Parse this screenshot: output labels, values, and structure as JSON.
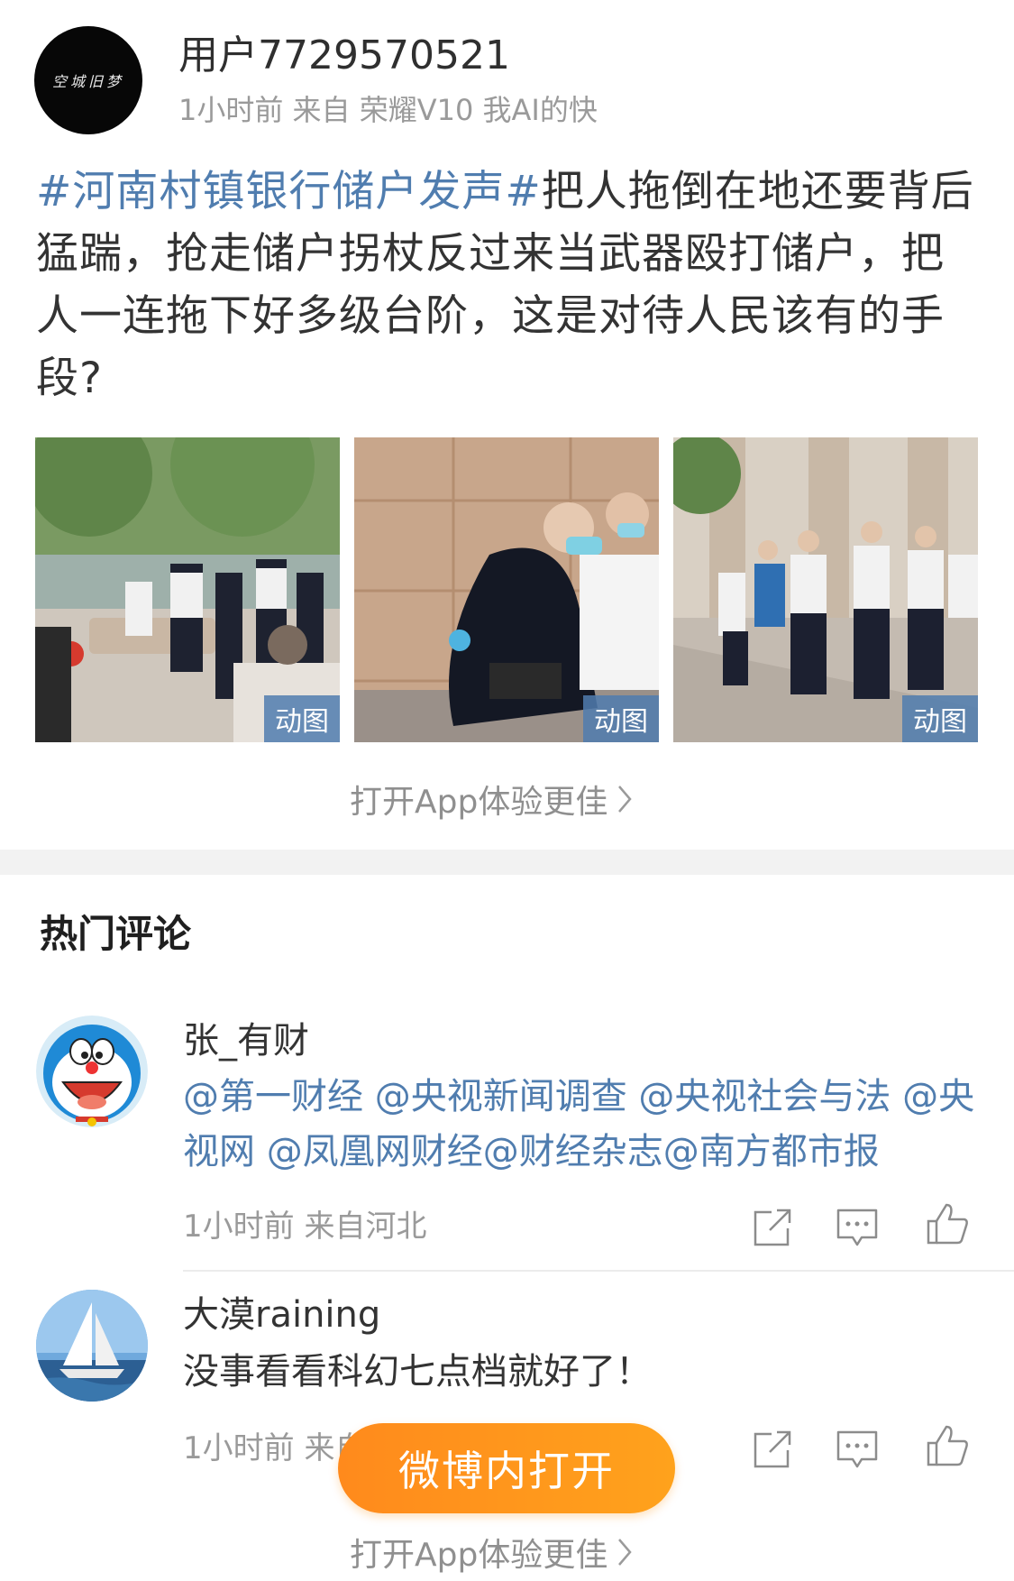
{
  "post": {
    "avatar_text": "空城旧梦",
    "username": "用户7729570521",
    "meta": "1小时前  来自 荣耀V10 我AI的快",
    "hashtag": "#河南村镇银行储户发声#",
    "text": "把人拖倒在地还要背后猛踹，抢走储户拐杖反过来当武器殴打储户，把人一连拖下好多级台阶，这是对待人民该有的手段?",
    "images": [
      {
        "badge": "动图"
      },
      {
        "badge": "动图"
      },
      {
        "badge": "动图"
      }
    ],
    "open_app": "打开App体验更佳"
  },
  "hot_comments": {
    "title": "热门评论",
    "comments": [
      {
        "name": "张_有财",
        "text": "@第一财经 @央视新闻调查 @央视社会与法 @央视网 @凤凰网财经@财经杂志@南方都市报",
        "meta": "1小时前  来自河北"
      },
      {
        "name": "大漠raining",
        "text": "没事看看科幻七点档就好了！",
        "meta": "1小时前  来自"
      }
    ]
  },
  "floating_button": "微博内打开",
  "bottom_open_app": "打开App体验更佳",
  "icons": [
    "share-icon",
    "comment-icon",
    "like-icon",
    "chevron-right-icon"
  ],
  "colors": {
    "link": "#507daf",
    "accent": "#ff9a1c",
    "meta": "#9a9a9a"
  }
}
